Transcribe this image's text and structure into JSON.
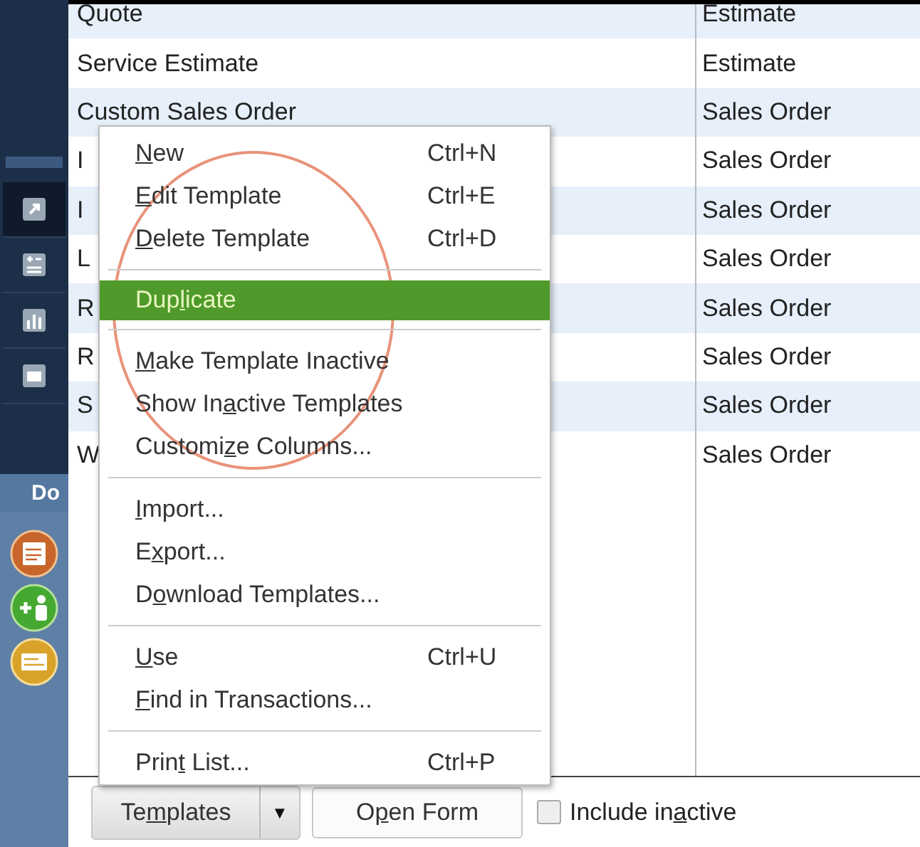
{
  "sidebar": {
    "tools": [
      {
        "selected": true
      },
      {
        "selected": false
      },
      {
        "selected": false
      },
      {
        "selected": false
      }
    ],
    "section_label": "Do"
  },
  "table": {
    "rows": [
      {
        "name": "Quote",
        "type": "Estimate"
      },
      {
        "name": "Service Estimate",
        "type": "Estimate"
      },
      {
        "name": "Custom Sales Order",
        "type": "Sales Order"
      },
      {
        "name": "I",
        "type": "Sales Order"
      },
      {
        "name": "I",
        "type": "Sales Order"
      },
      {
        "name": "L",
        "type": "Sales Order"
      },
      {
        "name": "R",
        "type": "Sales Order"
      },
      {
        "name": "R",
        "type": "Sales Order"
      },
      {
        "name": "S",
        "type": "Sales Order"
      },
      {
        "name": "W",
        "type": "Sales Order"
      }
    ]
  },
  "menu": {
    "items": [
      {
        "kind": "item",
        "label": {
          "key": "N",
          "post": "ew"
        },
        "shortcut": "Ctrl+N",
        "selected": false
      },
      {
        "kind": "item",
        "label": {
          "key": "E",
          "post": "dit Template"
        },
        "shortcut": "Ctrl+E",
        "selected": false
      },
      {
        "kind": "item",
        "label": {
          "key": "D",
          "post": "elete Template"
        },
        "shortcut": "Ctrl+D",
        "selected": false
      },
      {
        "kind": "separator"
      },
      {
        "kind": "item",
        "label": {
          "pre": "Dup",
          "key": "l",
          "post": "icate"
        },
        "selected": true
      },
      {
        "kind": "separator"
      },
      {
        "kind": "item",
        "label": {
          "key": "M",
          "post": "ake Template Inactive"
        },
        "selected": false
      },
      {
        "kind": "item",
        "label": {
          "pre": "Show In",
          "key": "a",
          "post": "ctive Templates"
        },
        "selected": false
      },
      {
        "kind": "item",
        "label": {
          "pre": "Customi",
          "key": "z",
          "post": "e Columns..."
        },
        "selected": false
      },
      {
        "kind": "separator"
      },
      {
        "kind": "item",
        "label": {
          "key": "I",
          "post": "mport..."
        },
        "selected": false
      },
      {
        "kind": "item",
        "label": {
          "pre": "E",
          "key": "x",
          "post": "port..."
        },
        "selected": false
      },
      {
        "kind": "item",
        "label": {
          "pre": "D",
          "key": "o",
          "post": "wnload Templates..."
        },
        "selected": false
      },
      {
        "kind": "separator"
      },
      {
        "kind": "item",
        "label": {
          "key": "U",
          "post": "se"
        },
        "shortcut": "Ctrl+U",
        "selected": false
      },
      {
        "kind": "item",
        "label": {
          "key": "F",
          "post": "ind in Transactions..."
        },
        "selected": false
      },
      {
        "kind": "separator"
      },
      {
        "kind": "item",
        "label": {
          "pre": "Prin",
          "key": "t",
          "post": " List..."
        },
        "shortcut": "Ctrl+P",
        "selected": false
      }
    ]
  },
  "footer": {
    "templates_button": {
      "pre": "Te",
      "key": "m",
      "post": "plates"
    },
    "dropdown_arrow": "▼",
    "open_form_button": {
      "pre": "O",
      "key": "p",
      "post": "en Form"
    },
    "include_inactive": {
      "checked": false,
      "label": {
        "pre": "Include in",
        "key": "a",
        "post": "ctive"
      }
    }
  }
}
